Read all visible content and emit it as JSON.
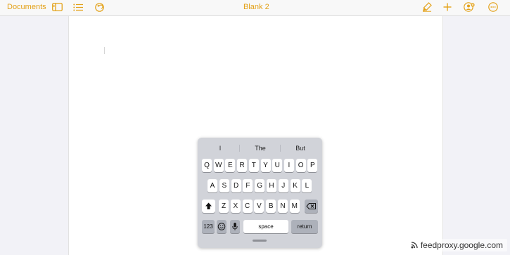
{
  "toolbar": {
    "documents_label": "Documents",
    "title": "Blank 2",
    "accent_color": "#e3a117"
  },
  "keyboard": {
    "suggestions": [
      "I",
      "The",
      "But"
    ],
    "row1": [
      "Q",
      "W",
      "E",
      "R",
      "T",
      "Y",
      "U",
      "I",
      "O",
      "P"
    ],
    "row2": [
      "A",
      "S",
      "D",
      "F",
      "G",
      "H",
      "J",
      "K",
      "L"
    ],
    "row3": [
      "Z",
      "X",
      "C",
      "V",
      "B",
      "N",
      "M"
    ],
    "numbers_label": "123",
    "space_label": "space",
    "return_label": "return"
  },
  "watermark": {
    "text": "feedproxy.google.com"
  }
}
